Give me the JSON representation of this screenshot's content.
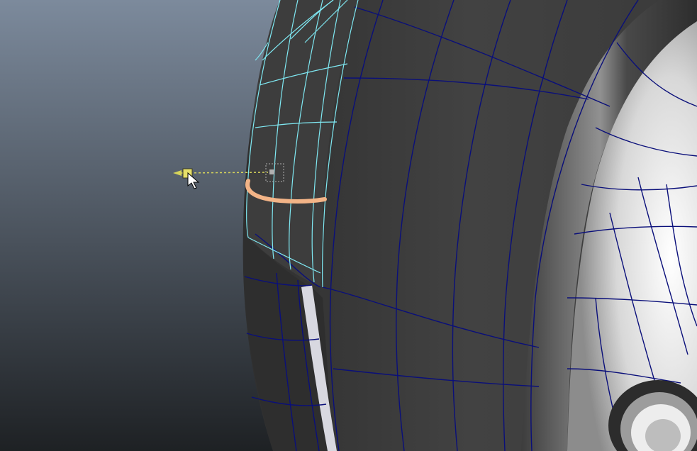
{
  "viewport": {
    "background_top": "#7C8A9C",
    "background_bottom": "#1E2124"
  },
  "mesh": {
    "surface_dark": "#3A3A3A",
    "surface_mid": "#4A4A4A",
    "surface_light": "#F2F2F2",
    "wire_color": "#0A0F7A",
    "selected_wire_color": "#7FE8F2",
    "highlight_edge_color": "#F3B487"
  },
  "manipulator": {
    "handle_color": "#E6E06A",
    "axis_color": "#D6D45A",
    "pivot_color": "#B0B0B0"
  },
  "cursor": {
    "icon": "arrow-cursor-icon"
  }
}
